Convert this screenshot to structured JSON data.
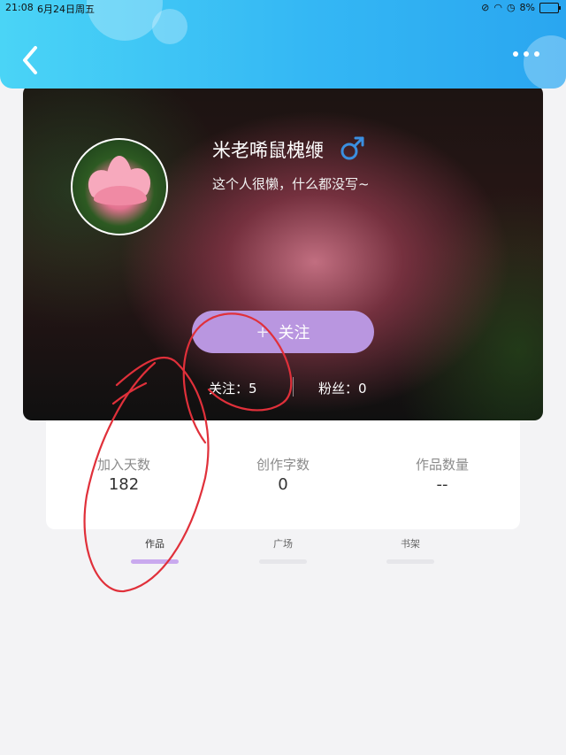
{
  "status_bar": {
    "time": "21:08",
    "date": "6月24日周五",
    "battery": "8%"
  },
  "header": {
    "back_icon": "chevron-left-icon",
    "more_icon": "more-dots-icon",
    "accent_color": "#34b7f4"
  },
  "profile": {
    "name": "米老唏鼠槐缏",
    "gender_icon": "male-icon",
    "bio": "这个人很懒，什么都没写~",
    "follow_button": "关注",
    "follow_plus": "+",
    "following_label": "关注：5",
    "fans_label": "粉丝：0",
    "button_color": "#b996e0"
  },
  "stats": [
    {
      "label": "加入天数",
      "value": "182"
    },
    {
      "label": "创作字数",
      "value": "0"
    },
    {
      "label": "作品数量",
      "value": "--"
    }
  ],
  "tabs": [
    {
      "label": "作品",
      "active": true
    },
    {
      "label": "广场",
      "active": false
    },
    {
      "label": "书架",
      "active": false
    }
  ]
}
